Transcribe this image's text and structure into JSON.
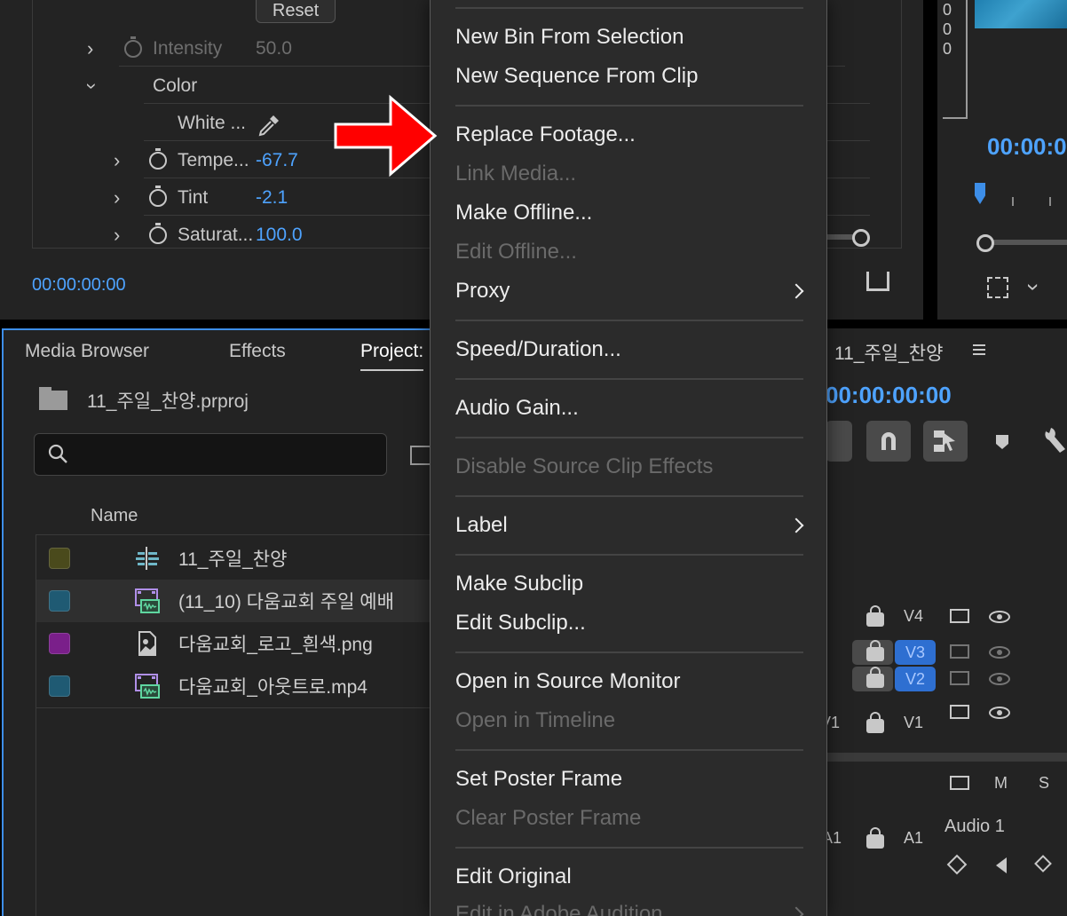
{
  "effect_controls": {
    "reset_label": "Reset",
    "rows": [
      {
        "label": "Intensity",
        "value": "50.0"
      },
      {
        "label": "Color",
        "value": ""
      },
      {
        "label": "White ...",
        "value": ""
      },
      {
        "label": "Tempe...",
        "value": "-67.7"
      },
      {
        "label": "Tint",
        "value": "-2.1"
      },
      {
        "label": "Saturat...",
        "value": "100.0"
      }
    ],
    "timecode": "00:00:00:00",
    "icons": [
      "chevron-right-icon",
      "stopwatch-icon",
      "eyedropper-icon",
      "export-icon"
    ]
  },
  "program_monitor": {
    "scale_values": [
      "0",
      "0",
      "0"
    ],
    "timecode": "00:00:0",
    "icons": [
      "safe-margins-icon",
      "chevron-down-icon"
    ]
  },
  "project_panel": {
    "tabs": [
      "Media Browser",
      "Effects",
      "Project:"
    ],
    "project_file": "11_주일_찬양.prproj",
    "search": {
      "placeholder": "",
      "value": ""
    },
    "column_header": "Name",
    "items": [
      {
        "name": "11_주일_찬양",
        "type": "sequence",
        "label_color": "#4a4a1c"
      },
      {
        "name": "(11_10) 다움교회 주일 예배",
        "type": "video",
        "label_color": "#1f5a73"
      },
      {
        "name": "다움교회_로고_흰색.png",
        "type": "image",
        "label_color": "#7a1f8a"
      },
      {
        "name": "다움교회_아웃트로.mp4",
        "type": "video",
        "label_color": "#1f5a73"
      }
    ]
  },
  "timeline": {
    "title": "11_주일_찬양",
    "timecode": "00:00:00:00",
    "tracks": [
      {
        "label": "V4"
      },
      {
        "label": "V3"
      },
      {
        "label": "V2"
      },
      {
        "label": "V1",
        "source": "V1"
      },
      {
        "label": "A1",
        "source": "A1",
        "name": "Audio 1"
      }
    ],
    "audio_header": [
      "M",
      "S"
    ],
    "icons": [
      "sequence-icon",
      "magnet-icon",
      "linked-selection-icon",
      "marker-icon",
      "wrench-icon"
    ]
  },
  "context_menu": {
    "items": [
      {
        "label": "New Bin From Selection",
        "enabled": true
      },
      {
        "label": "New Sequence From Clip",
        "enabled": true
      },
      {
        "label": "Replace Footage...",
        "enabled": true
      },
      {
        "label": "Link Media...",
        "enabled": false
      },
      {
        "label": "Make Offline...",
        "enabled": true
      },
      {
        "label": "Edit Offline...",
        "enabled": false
      },
      {
        "label": "Proxy",
        "enabled": true,
        "submenu": true
      },
      {
        "label": "Speed/Duration...",
        "enabled": true
      },
      {
        "label": "Audio Gain...",
        "enabled": true
      },
      {
        "label": "Disable Source Clip Effects",
        "enabled": false
      },
      {
        "label": "Label",
        "enabled": true,
        "submenu": true
      },
      {
        "label": "Make Subclip",
        "enabled": true
      },
      {
        "label": "Edit Subclip...",
        "enabled": true
      },
      {
        "label": "Open in Source Monitor",
        "enabled": true
      },
      {
        "label": "Open in Timeline",
        "enabled": false
      },
      {
        "label": "Set Poster Frame",
        "enabled": true
      },
      {
        "label": "Clear Poster Frame",
        "enabled": false
      },
      {
        "label": "Edit Original",
        "enabled": true
      },
      {
        "label": "Edit in Adobe Audition",
        "enabled": false,
        "submenu": true
      }
    ]
  },
  "colors": {
    "accent_blue": "#4ea3ff",
    "panel_bg": "#232323",
    "menu_bg": "#2b2b2b",
    "arrow_red": "#ff0000"
  }
}
